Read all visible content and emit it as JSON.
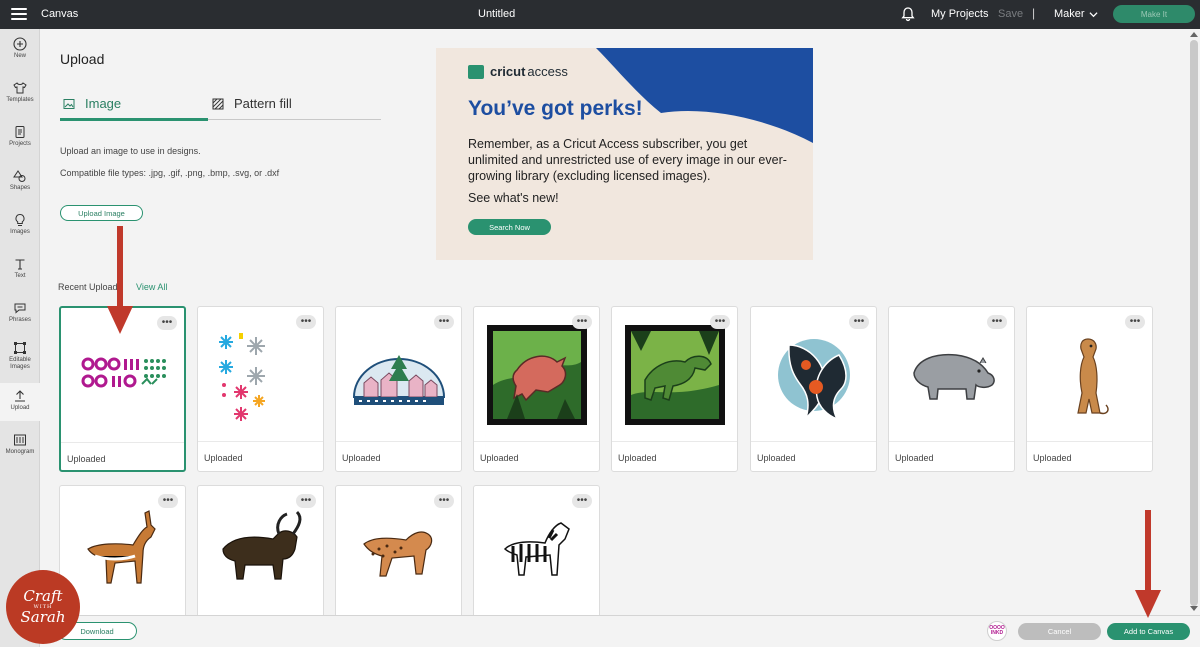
{
  "topbar": {
    "app_title": "Canvas",
    "doc_title": "Untitled",
    "my_projects": "My Projects",
    "save": "Save",
    "separator": "|",
    "machine": "Maker",
    "make_it": "Make It"
  },
  "rail": {
    "items": [
      {
        "label": "New",
        "icon": "plus-circle-icon"
      },
      {
        "label": "Templates",
        "icon": "shirt-icon"
      },
      {
        "label": "Projects",
        "icon": "projects-icon"
      },
      {
        "label": "Shapes",
        "icon": "shapes-icon"
      },
      {
        "label": "Images",
        "icon": "lightbulb-icon"
      },
      {
        "label": "Text",
        "icon": "text-icon"
      },
      {
        "label": "Phrases",
        "icon": "speech-bubble-icon"
      },
      {
        "label": "Editable Images",
        "icon": "editable-images-icon"
      },
      {
        "label": "Upload",
        "icon": "upload-icon"
      },
      {
        "label": "Monogram",
        "icon": "monogram-icon"
      }
    ]
  },
  "panel": {
    "title": "Upload",
    "tabs": {
      "image": "Image",
      "pattern": "Pattern fill"
    },
    "description": "Upload an image to use in designs.",
    "file_types": "Compatible file types: .jpg, .gif, .png, .bmp, .svg, or .dxf",
    "upload_button": "Upload Image"
  },
  "banner": {
    "brand": "cricut",
    "brand_suffix": "access",
    "headline": "You’ve got perks!",
    "body": "Remember, as a Cricut Access subscriber, you get unlimited and unrestricted use of every image in our ever-growing library (excluding licensed images).",
    "link": "See what's new!",
    "button": "Search Now",
    "colors": {
      "background": "#f1e7de",
      "swoosh": "#1d4ea1",
      "accent": "#2a9270"
    }
  },
  "recent": {
    "label": "Recent Uploads",
    "view_all": "View All",
    "more_glyph": "•••",
    "cards": [
      {
        "label": "Uploaded",
        "image": "purple-pattern-design",
        "selected": true
      },
      {
        "label": "Uploaded",
        "image": "snowflake-assortment"
      },
      {
        "label": "Uploaded",
        "image": "winter-village-dome"
      },
      {
        "label": "Uploaded",
        "image": "dinosaur-triceratops-shadowbox"
      },
      {
        "label": "Uploaded",
        "image": "dinosaur-trex-shadowbox"
      },
      {
        "label": "Uploaded",
        "image": "koi-fish-circle"
      },
      {
        "label": "Uploaded",
        "image": "hippo"
      },
      {
        "label": "Uploaded",
        "image": "meerkat"
      },
      {
        "label": "",
        "image": "gazelle"
      },
      {
        "label": "",
        "image": "buffalo"
      },
      {
        "label": "",
        "image": "hyena"
      },
      {
        "label": "",
        "image": "zebra"
      }
    ]
  },
  "bottombar": {
    "download": "Download",
    "avatar_text": "OOOO INKD",
    "cancel": "Cancel",
    "add_to_canvas": "Add to Canvas"
  },
  "watermark": {
    "line1": "Craft",
    "line2": "WITH",
    "line3": "Sarah"
  },
  "colors": {
    "accent": "#2a9270",
    "topbar": "#2a2d31",
    "arrow": "#c0392b"
  }
}
